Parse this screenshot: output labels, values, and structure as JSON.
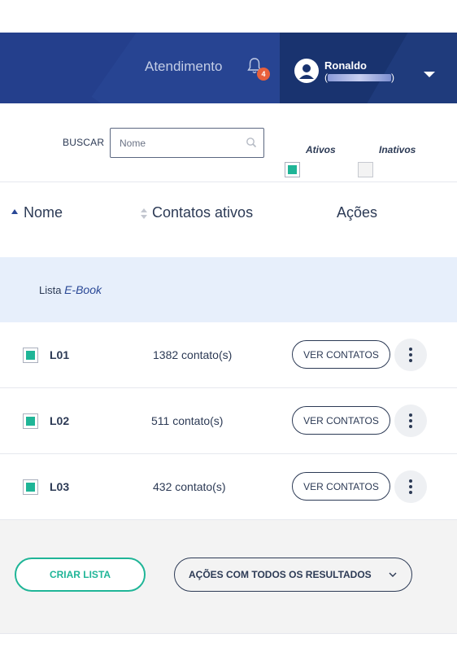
{
  "header": {
    "atendimento": "Atendimento",
    "notification_count": "4",
    "user_name": "Ronaldo",
    "user_sub_open": "(",
    "user_sub_close": ")"
  },
  "filters": {
    "search_label": "BUSCAR",
    "search_placeholder": "Nome",
    "active_label": "Ativos",
    "inactive_label": "Inativos"
  },
  "table": {
    "col_name": "Nome",
    "col_contacts": "Contatos ativos",
    "col_actions": "Ações"
  },
  "group": {
    "prefix": "Lista",
    "name": "E-Book"
  },
  "rows": [
    {
      "name": "L01",
      "count": "1382 contato(s)",
      "button": "VER CONTATOS"
    },
    {
      "name": "L02",
      "count": "511 contato(s)",
      "button": "VER CONTATOS"
    },
    {
      "name": "L03",
      "count": "432 contato(s)",
      "button": "VER CONTATOS"
    }
  ],
  "footer": {
    "create_label": "CRIAR LISTA",
    "bulk_label": "AÇÕES COM TODOS OS RESULTADOS"
  },
  "colors": {
    "header_bg": "#243f8c",
    "user_bg": "#19336f",
    "accent_green": "#1fb597",
    "badge": "#e8603c"
  }
}
